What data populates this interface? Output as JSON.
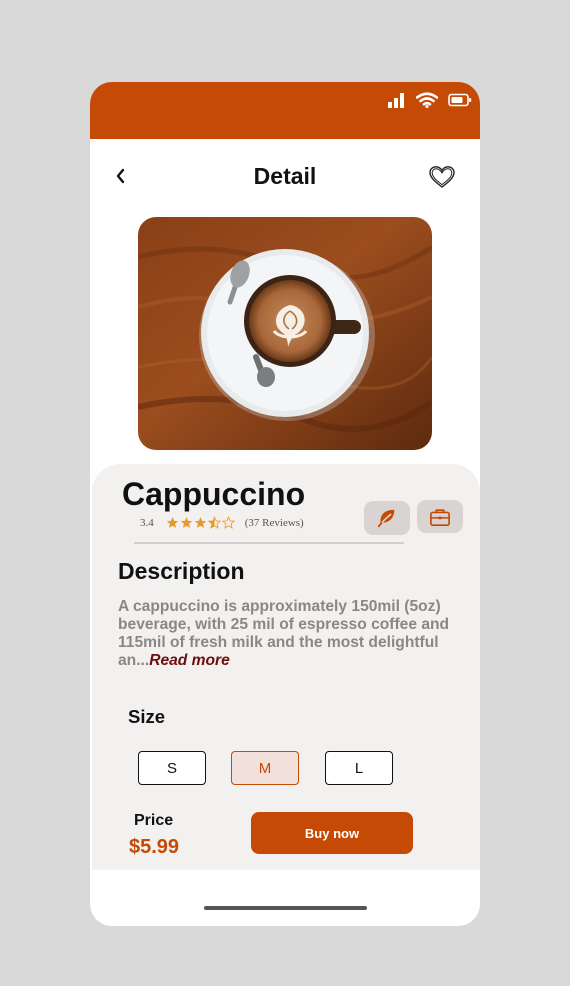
{
  "colors": {
    "accent": "#c44a05",
    "sheet_bg": "#f3f1f0",
    "description_text": "#8b8785",
    "read_more": "#6b0f0f",
    "star": "#e89a2c"
  },
  "status_bar": {
    "icons": [
      "signal-icon",
      "wifi-icon",
      "battery-icon"
    ]
  },
  "header": {
    "title": "Detail",
    "back_icon": "chevron-left-icon",
    "favorite_icon": "heart-icon"
  },
  "product": {
    "name": "Cappuccino",
    "rating": "3.4",
    "rating_stars": 3.4,
    "reviews": "(37 Reviews)",
    "feature_icons": [
      "leaf-icon",
      "briefcase-icon"
    ]
  },
  "description": {
    "heading": "Description",
    "text": "A cappuccino is approximately 150mil (5oz) beverage, with 25 mil of espresso coffee and 115mil of fresh milk and the most delightful an...",
    "read_more": "Read more"
  },
  "size": {
    "heading": "Size",
    "options": [
      "S",
      "M",
      "L"
    ],
    "selected": "M"
  },
  "price": {
    "label": "Price",
    "value": "$5.99"
  },
  "actions": {
    "buy_label": "Buy now"
  }
}
